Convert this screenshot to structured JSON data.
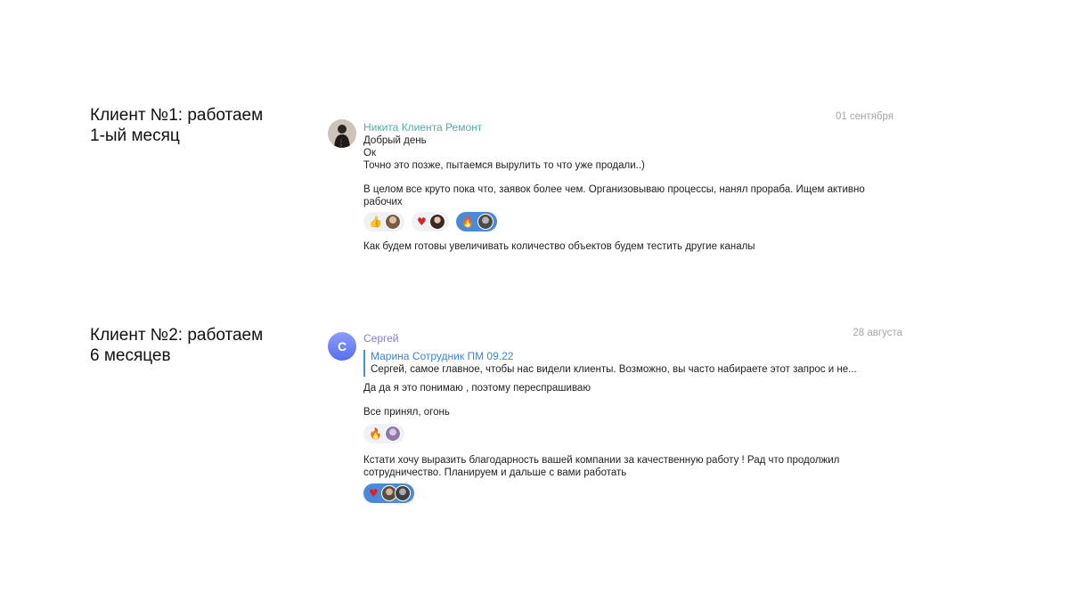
{
  "clients": [
    {
      "label_line1": "Клиент №1: работаем",
      "label_line2": "1-ый месяц",
      "chat": {
        "author": "Никита Клиента Ремонт",
        "date": "01 сентября",
        "lines": [
          "Добрый день",
          "Ок",
          "Точно это позже, пытаемся вырулить то что уже продали..)"
        ],
        "paragraph": "В целом все круто пока что, заявок более чем. Организовываю процессы, нанял прораба.  Ищем активно рабочих",
        "reactions": [
          {
            "emoji": "👍",
            "emoji_icon": "thumbs-up-icon",
            "active": false
          },
          {
            "emoji": "♥",
            "emoji_icon": "heart-icon",
            "active": false
          },
          {
            "emoji": "🔥",
            "emoji_icon": "fire-icon",
            "active": true
          }
        ],
        "last_line": "Как будем готовы увеличивать количество объектов будем тестить другие каналы"
      }
    },
    {
      "label_line1": "Клиент №2: работаем",
      "label_line2": "6 месяцев",
      "chat": {
        "avatar_letter": "С",
        "author": "Сергей",
        "date": "28 августа",
        "quote_author": "Марина Сотрудник ПМ 09.22",
        "quote_text": "Сергей, самое главное, чтобы нас видели клиенты. Возможно, вы часто набираете этот запрос и не...",
        "reply": "Да да я это понимаю , поэтому переспрашиваю",
        "message2": "Все принял, огонь",
        "reactions_a": [
          {
            "emoji": "🔥",
            "emoji_icon": "fire-icon",
            "active": false
          }
        ],
        "paragraph": "Кстати хочу выразить благодарность вашей компании за качественную работу ! Рад что продолжил сотрудничество. Планируем и дальше с вами работать",
        "reactions_b": [
          {
            "emoji": "♥",
            "emoji_icon": "heart-icon",
            "active": true
          }
        ]
      }
    }
  ],
  "colors": {
    "author_green": "#4bb3a2",
    "author_purple": "#8a79d6",
    "quote_accent": "#4a8fd4",
    "active_reaction": "#4a8ad6",
    "date_gray": "#a5a5a5"
  }
}
